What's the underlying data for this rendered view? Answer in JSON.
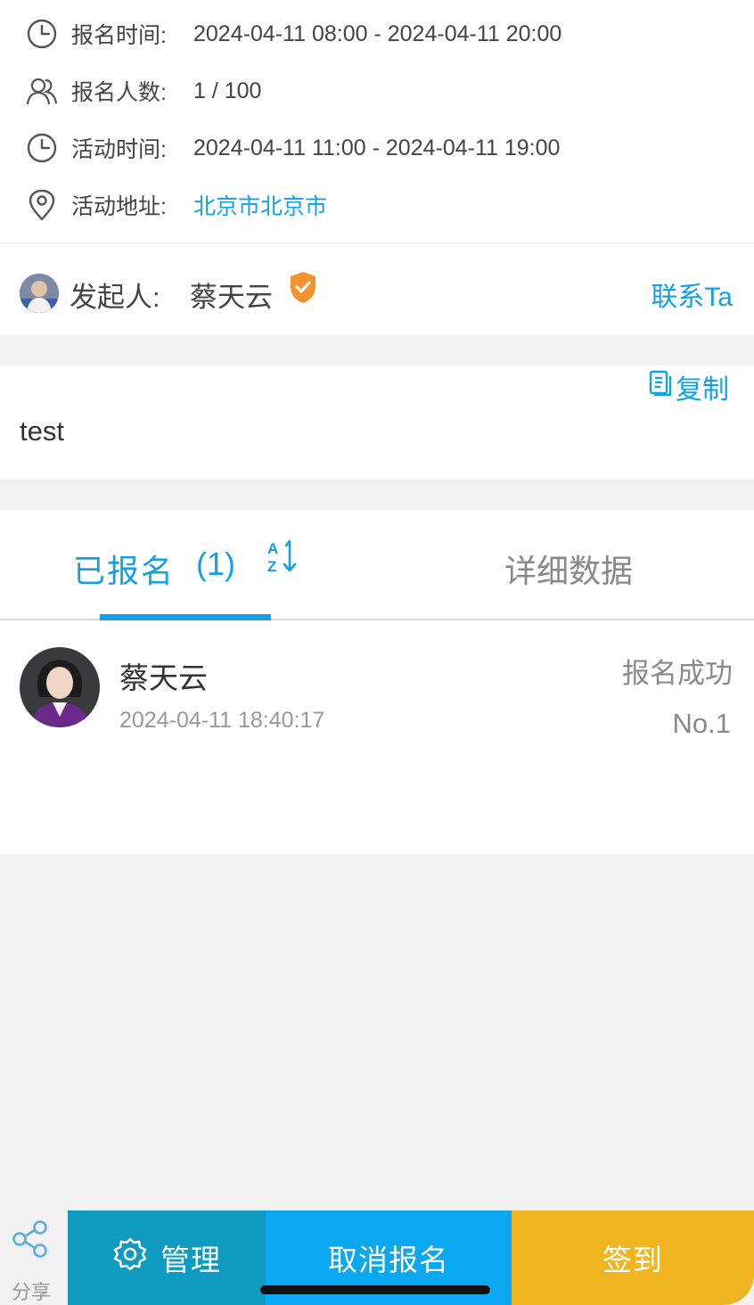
{
  "event_info": {
    "registration_time_label": "报名时间:",
    "registration_time_value": "2024-04-11 08:00 - 2024-04-11 20:00",
    "participants_label": "报名人数:",
    "participants_value": "1 / 100",
    "activity_time_label": "活动时间:",
    "activity_time_value": "2024-04-11 11:00 - 2024-04-11 19:00",
    "address_label": "活动地址:",
    "address_value": "北京市北京市"
  },
  "organizer": {
    "label": "发起人:",
    "name": "蔡天云",
    "contact_label": "联系Ta"
  },
  "description": {
    "copy_label": "复制",
    "text": "test"
  },
  "tabs": {
    "signed_label": "已报名",
    "signed_count": "(1)",
    "data_label": "详细数据"
  },
  "registrants": [
    {
      "name": "蔡天云",
      "time": "2024-04-11 18:40:17",
      "status": "报名成功",
      "number": "No.1"
    }
  ],
  "bottom_bar": {
    "share_label": "分享",
    "manage_label": "管理",
    "cancel_label": "取消报名",
    "checkin_label": "签到"
  },
  "colors": {
    "accent": "#12a1e8",
    "manage_bg": "#0e9bbf",
    "cancel_bg": "#0aa8f0",
    "checkin_bg": "#f0b520",
    "verified_badge": "#f5922f"
  },
  "icons": {
    "registration_time": "clock-icon",
    "participants": "users-icon",
    "activity_time": "clock-icon",
    "address": "location-pin-icon",
    "verified": "verified-shield-icon",
    "copy": "copy-icon",
    "sort": "sort-az-icon",
    "share": "share-icon",
    "manage": "gear-icon"
  }
}
